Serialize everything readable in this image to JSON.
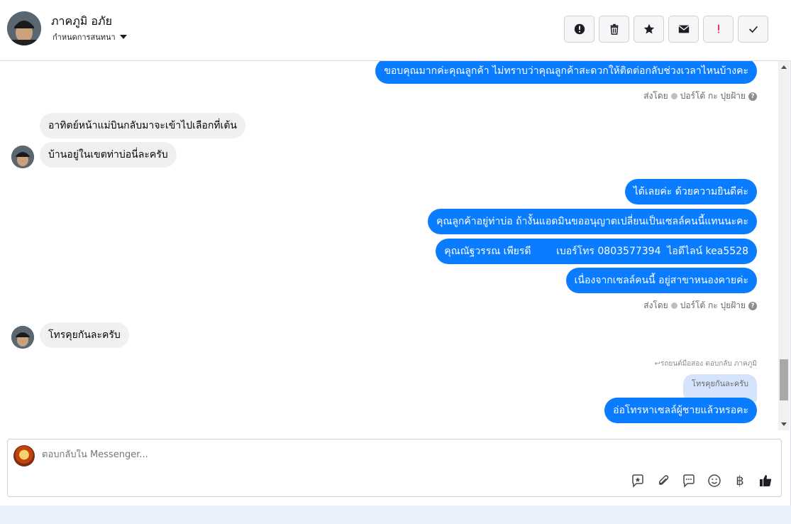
{
  "header": {
    "user_name": "ภาคภูมิ อภัย",
    "assign_label": "กำหนดการสนทนา",
    "actions": [
      {
        "name": "report-icon"
      },
      {
        "name": "trash-icon"
      },
      {
        "name": "star-icon"
      },
      {
        "name": "mail-icon"
      },
      {
        "name": "important-icon",
        "color": "#e41e3f"
      },
      {
        "name": "check-icon"
      }
    ]
  },
  "thread": {
    "msg1": "ขอบคุณมากค่ะคุณลูกค้า  ไม่ทราบว่าคุณลูกค้าสะดวกให้ติดต่อกลับช่วงเวลาไหนบ้างคะ",
    "sent_by_1": "ส่งโดย",
    "agent_1": "ปอร์โต้ กะ ปุยฝ้าย",
    "in1": "อาทิตย์หน้าแม่บินกลับมาจะเข้าไปเลือกที่เต้น",
    "in2": "บ้านอยู่ในเขตท่าบ่อนี่ละครับ",
    "out2": "ได้เลยค่ะ ด้วยความยินดีค่ะ",
    "out3": "คุณลูกค้าอยู่ท่าบ่อ ถ้างั้นแอดมินขออนุญาตเปลี่ยนเป็นเซลล์คนนี้แทนนะคะ",
    "out4": "คุณณัฐวรรณ เพียรดี        เบอร์โทร 0803577394  ไอดีไลน์ kea5528",
    "out5": "เนื่องจากเซลล์คนนี้ อยู่สาขาหนองคายค่ะ",
    "sent_by_2": "ส่งโดย",
    "agent_2": "ปอร์โต้ กะ ปุยฝ้าย",
    "in3": "โทรคุยกันละครับ",
    "reply_meta": "รถยนต์มือสอง ตอบกลับ ภาคภูมิ",
    "reply_quote": "โทรคุยกันละครับ",
    "out6": "อ่อโทรหาเซลล์ผู้ชายแล้วหรอคะ"
  },
  "composer": {
    "placeholder": "ตอบกลับใน Messenger...",
    "tools": [
      "saved-reply-icon",
      "attachment-icon",
      "chat-icon",
      "emoji-icon",
      "baht-icon",
      "like-icon"
    ],
    "baht_symbol": "฿"
  },
  "colors": {
    "outgoing_bubble": "#0a7cff",
    "incoming_bubble": "#f0f0f0",
    "reply_quote_bg": "#d6e4fb"
  }
}
